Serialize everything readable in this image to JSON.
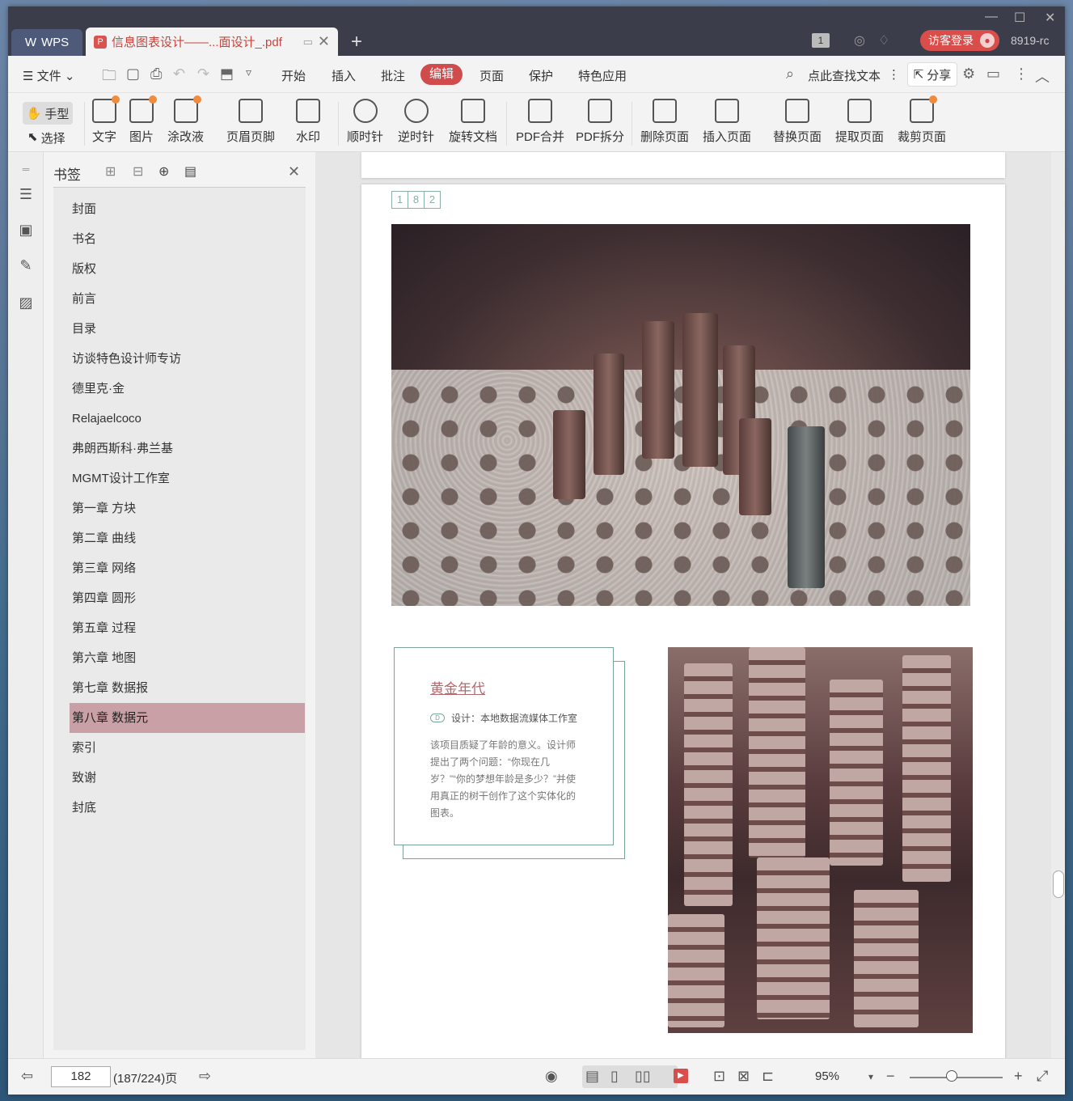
{
  "window": {
    "app_tab": "WPS",
    "doc_tab": "信息图表设计——...面设计_.pdf",
    "page_badge": "1",
    "login_label": "访客登录",
    "version": "8919-rc"
  },
  "menu": {
    "file": "文件",
    "items": [
      "开始",
      "插入",
      "批注",
      "编辑",
      "页面",
      "保护",
      "特色应用"
    ],
    "active": "编辑",
    "search": "点此查找文本",
    "share": "分享"
  },
  "toolbar": {
    "hand": "手型",
    "select": "选择",
    "tools": [
      "文字",
      "图片",
      "涂改液",
      "页眉页脚",
      "水印",
      "顺时针",
      "逆时针",
      "旋转文档",
      "PDF合并",
      "PDF拆分",
      "删除页面",
      "插入页面",
      "替换页面",
      "提取页面",
      "裁剪页面"
    ]
  },
  "bookmark": {
    "title": "书签",
    "items": [
      "封面",
      "书名",
      "版权",
      "前言",
      "目录",
      "访谈特色设计师专访",
      "德里克·金",
      "Relajaelcoco",
      "弗朗西斯科·弗兰基",
      "MGMT设计工作室",
      "第一章 方块",
      "第二章 曲线",
      "第三章 网络",
      "第四章 圆形",
      "第五章 过程",
      "第六章 地图",
      "第七章 数据报",
      "第八章 数据元",
      "索引",
      "致谢",
      "封底"
    ],
    "selected_index": 17
  },
  "page": {
    "page_number_digits": [
      "1",
      "8",
      "2"
    ],
    "card_title": "黄金年代",
    "card_tag": "设计：本地数据流媒体工作室",
    "card_body": "该项目质疑了年龄的意义。设计师提出了两个问题：“你现在几岁？”“你的梦想年龄是多少？”并使用真正的树干创作了这个实体化的图表。"
  },
  "status": {
    "page_input": "182",
    "page_total": "(187/224)页",
    "zoom": "95%"
  }
}
